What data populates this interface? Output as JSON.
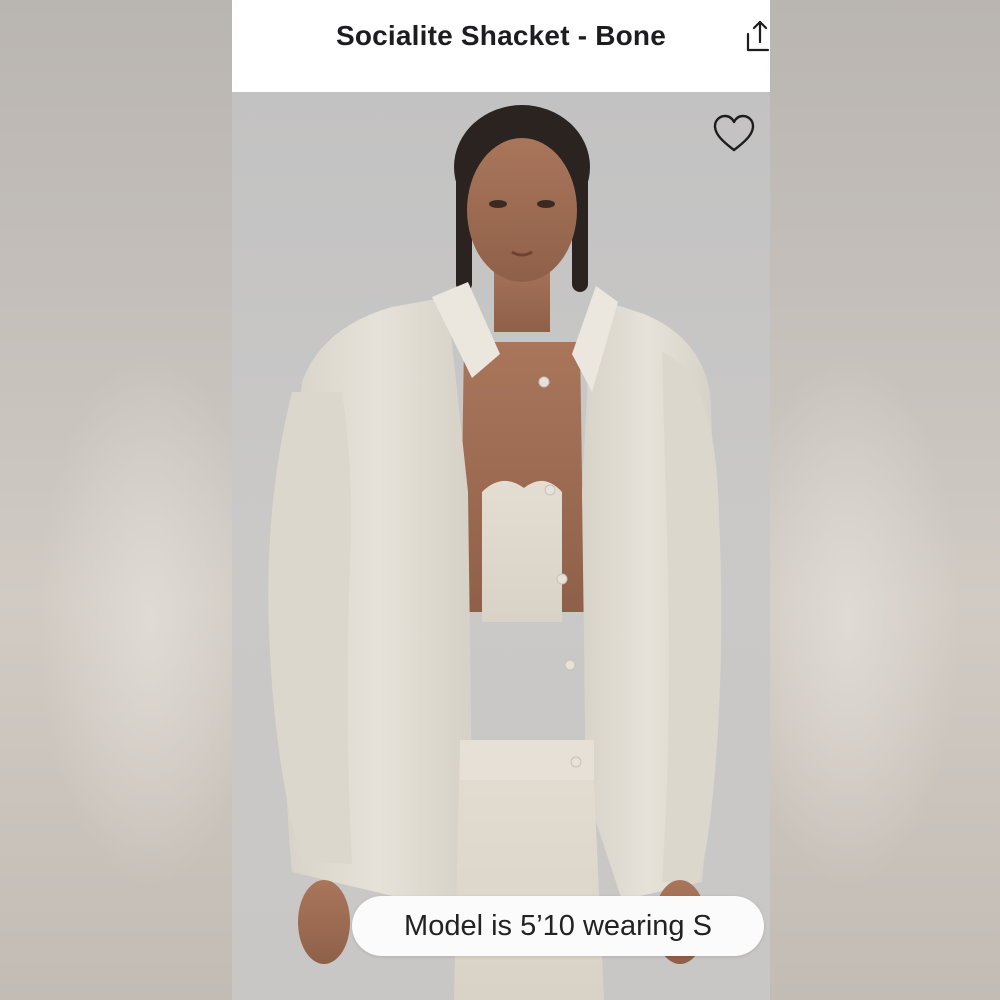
{
  "header": {
    "title": "Socialite Shacket - Bone",
    "share_icon": "share-icon"
  },
  "product_image": {
    "favorite_icon": "heart-outline-icon",
    "caption": "Model is 5’10 wearing S"
  },
  "colors": {
    "header_bg": "#ffffff",
    "title_text": "#1d1d1f",
    "caption_bg": "#fbfbfb",
    "photo_bg": "#c8c7c6",
    "garment": "#e2ddd3"
  }
}
